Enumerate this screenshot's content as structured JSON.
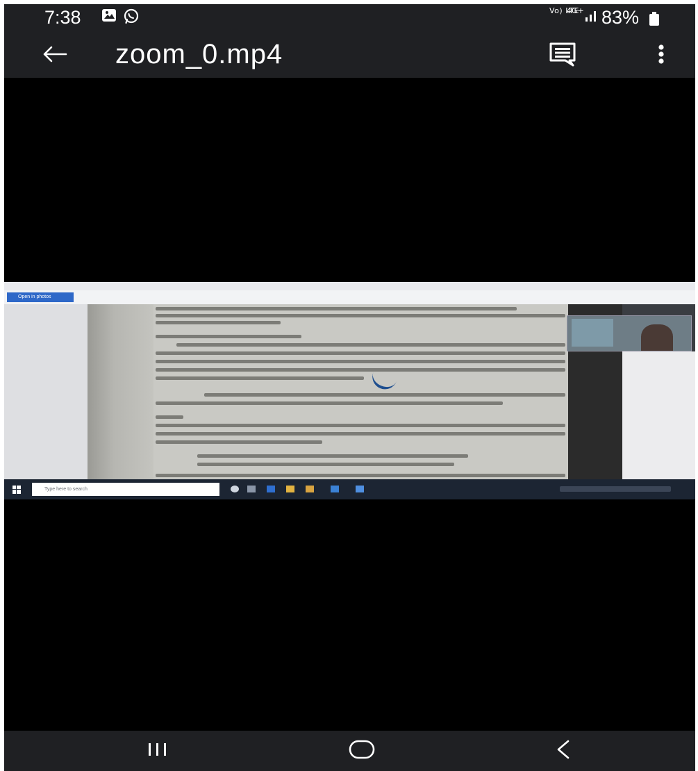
{
  "status_bar": {
    "time": "7:38",
    "network_label_1": "Vo) LTE",
    "network_label_2": "4G+",
    "battery": "83%",
    "icons": [
      "gallery-icon",
      "whatsapp-icon",
      "signal-icon",
      "battery-icon"
    ]
  },
  "app_bar": {
    "title": "zoom_0.mp4",
    "icons": [
      "back-arrow-icon",
      "subtitles-icon",
      "more-vert-icon"
    ]
  },
  "video": {
    "open_button_label": "Open in photos",
    "taskbar_search_placeholder": "Type here to search"
  },
  "nav_bar": {
    "icons": [
      "recent-apps-icon",
      "home-icon",
      "back-icon"
    ]
  },
  "colors": {
    "bar_background": "#1f2023",
    "screen_background": "#000000",
    "text": "#ffffff"
  }
}
